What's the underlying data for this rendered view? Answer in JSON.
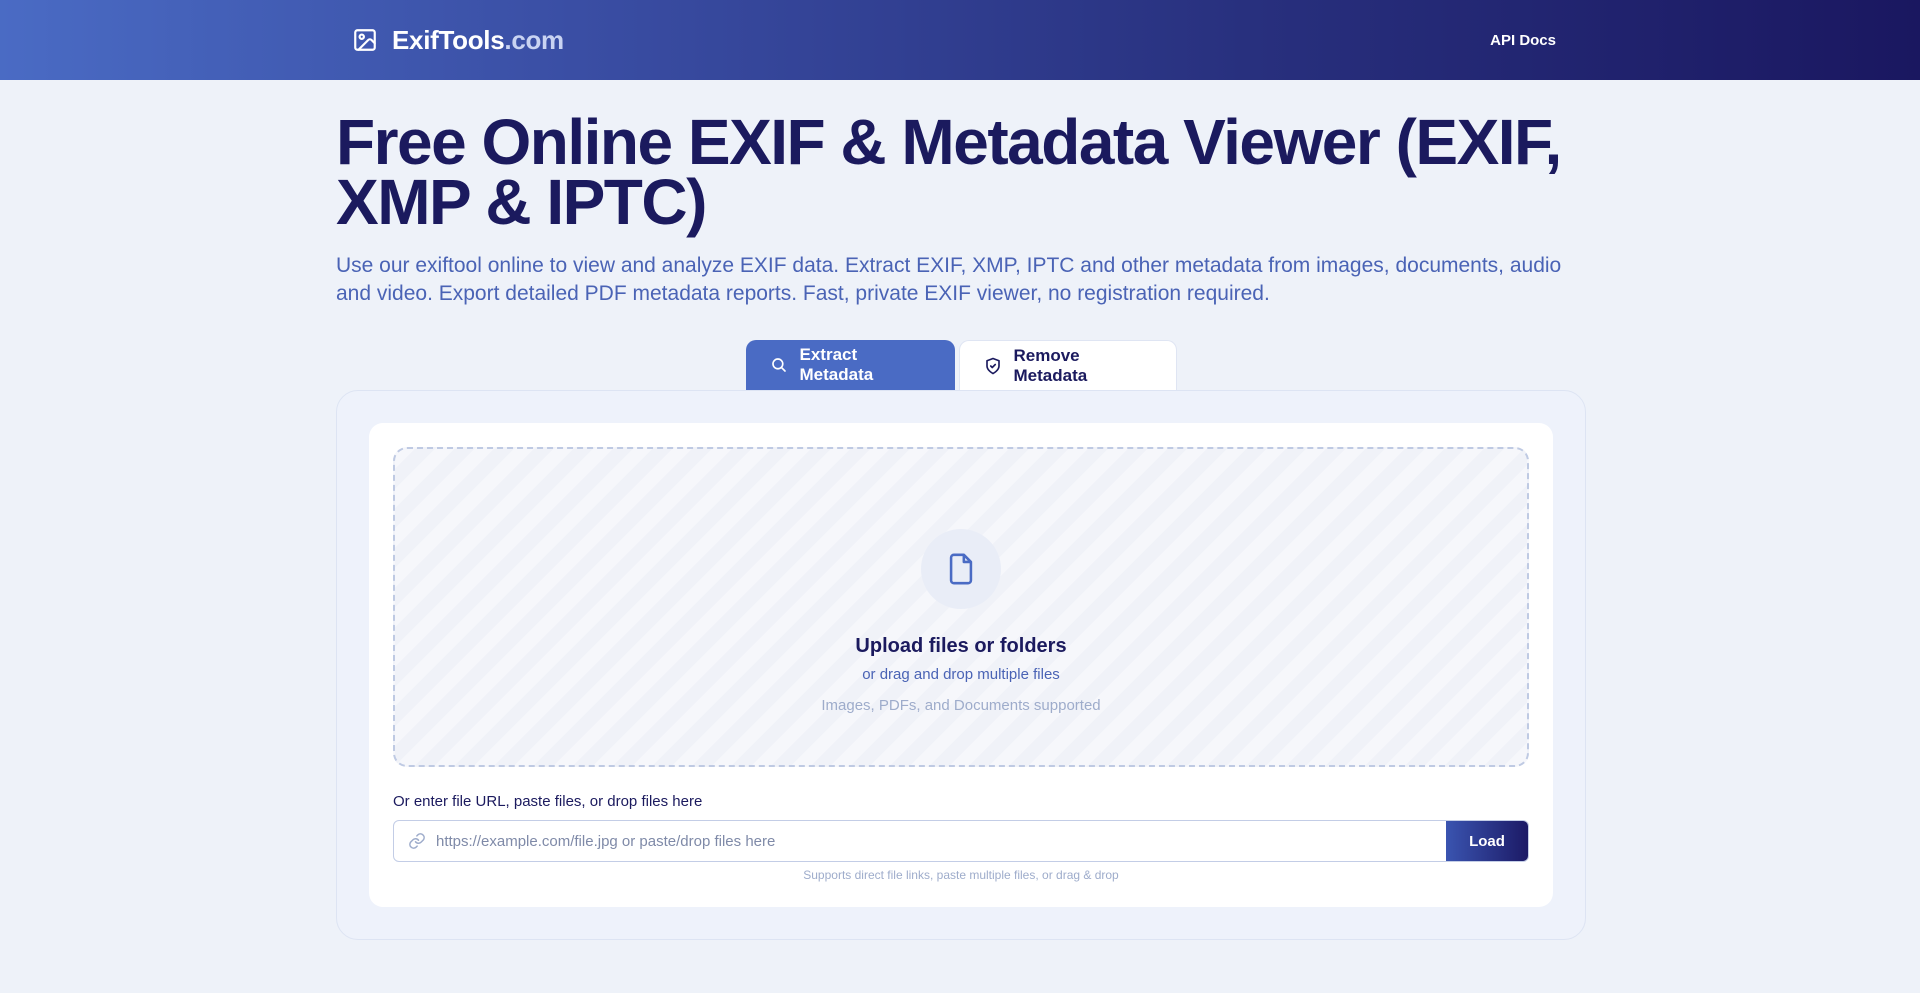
{
  "header": {
    "brand_name": "ExifTools",
    "brand_tld": ".com",
    "nav_api_docs": "API Docs",
    "logo_icon": "image-icon"
  },
  "hero": {
    "title": "Free Online EXIF & Metadata Viewer (EXIF, XMP & IPTC)",
    "description": "Use our exiftool online to view and analyze EXIF data. Extract EXIF, XMP, IPTC and other metadata from images, documents, audio and video. Export detailed PDF metadata reports. Fast, private EXIF viewer, no registration required."
  },
  "tabs": [
    {
      "label": "Extract Metadata",
      "icon": "search-icon",
      "active": true
    },
    {
      "label": "Remove Metadata",
      "icon": "shield-check-icon",
      "active": false
    }
  ],
  "dropzone": {
    "icon": "file-icon",
    "title": "Upload files or folders",
    "subtitle": "or drag and drop multiple files",
    "note": "Images, PDFs, and Documents supported"
  },
  "url_input": {
    "label": "Or enter file URL, paste files, or drop files here",
    "placeholder": "https://example.com/file.jpg or paste/drop files here",
    "value": "",
    "icon": "link-icon",
    "button_label": "Load",
    "help": "Supports direct file links, paste multiple files, or drag & drop"
  },
  "colors": {
    "primary_dark": "#1b1a5e",
    "accent": "#4a6bc4",
    "muted_text": "#9eaccb",
    "page_bg": "#eef2f9"
  }
}
